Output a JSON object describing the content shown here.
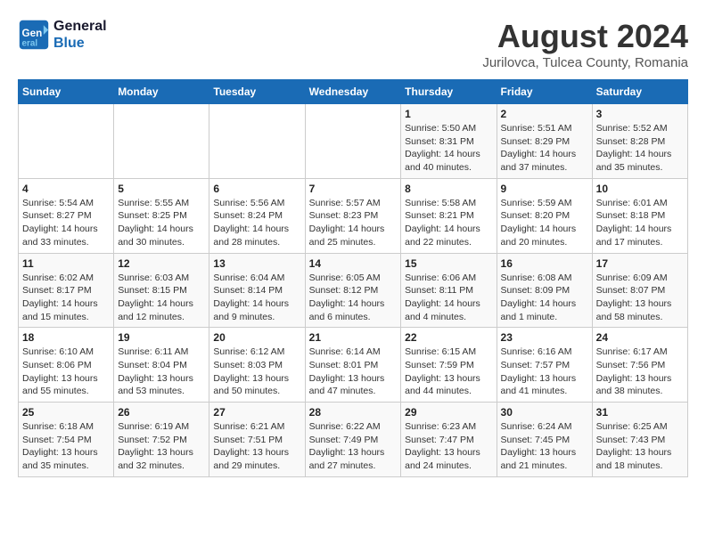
{
  "logo": {
    "line1": "General",
    "line2": "Blue"
  },
  "title": "August 2024",
  "subtitle": "Jurilovca, Tulcea County, Romania",
  "days_header": [
    "Sunday",
    "Monday",
    "Tuesday",
    "Wednesday",
    "Thursday",
    "Friday",
    "Saturday"
  ],
  "weeks": [
    [
      {
        "num": "",
        "info": ""
      },
      {
        "num": "",
        "info": ""
      },
      {
        "num": "",
        "info": ""
      },
      {
        "num": "",
        "info": ""
      },
      {
        "num": "1",
        "info": "Sunrise: 5:50 AM\nSunset: 8:31 PM\nDaylight: 14 hours\nand 40 minutes."
      },
      {
        "num": "2",
        "info": "Sunrise: 5:51 AM\nSunset: 8:29 PM\nDaylight: 14 hours\nand 37 minutes."
      },
      {
        "num": "3",
        "info": "Sunrise: 5:52 AM\nSunset: 8:28 PM\nDaylight: 14 hours\nand 35 minutes."
      }
    ],
    [
      {
        "num": "4",
        "info": "Sunrise: 5:54 AM\nSunset: 8:27 PM\nDaylight: 14 hours\nand 33 minutes."
      },
      {
        "num": "5",
        "info": "Sunrise: 5:55 AM\nSunset: 8:25 PM\nDaylight: 14 hours\nand 30 minutes."
      },
      {
        "num": "6",
        "info": "Sunrise: 5:56 AM\nSunset: 8:24 PM\nDaylight: 14 hours\nand 28 minutes."
      },
      {
        "num": "7",
        "info": "Sunrise: 5:57 AM\nSunset: 8:23 PM\nDaylight: 14 hours\nand 25 minutes."
      },
      {
        "num": "8",
        "info": "Sunrise: 5:58 AM\nSunset: 8:21 PM\nDaylight: 14 hours\nand 22 minutes."
      },
      {
        "num": "9",
        "info": "Sunrise: 5:59 AM\nSunset: 8:20 PM\nDaylight: 14 hours\nand 20 minutes."
      },
      {
        "num": "10",
        "info": "Sunrise: 6:01 AM\nSunset: 8:18 PM\nDaylight: 14 hours\nand 17 minutes."
      }
    ],
    [
      {
        "num": "11",
        "info": "Sunrise: 6:02 AM\nSunset: 8:17 PM\nDaylight: 14 hours\nand 15 minutes."
      },
      {
        "num": "12",
        "info": "Sunrise: 6:03 AM\nSunset: 8:15 PM\nDaylight: 14 hours\nand 12 minutes."
      },
      {
        "num": "13",
        "info": "Sunrise: 6:04 AM\nSunset: 8:14 PM\nDaylight: 14 hours\nand 9 minutes."
      },
      {
        "num": "14",
        "info": "Sunrise: 6:05 AM\nSunset: 8:12 PM\nDaylight: 14 hours\nand 6 minutes."
      },
      {
        "num": "15",
        "info": "Sunrise: 6:06 AM\nSunset: 8:11 PM\nDaylight: 14 hours\nand 4 minutes."
      },
      {
        "num": "16",
        "info": "Sunrise: 6:08 AM\nSunset: 8:09 PM\nDaylight: 14 hours\nand 1 minute."
      },
      {
        "num": "17",
        "info": "Sunrise: 6:09 AM\nSunset: 8:07 PM\nDaylight: 13 hours\nand 58 minutes."
      }
    ],
    [
      {
        "num": "18",
        "info": "Sunrise: 6:10 AM\nSunset: 8:06 PM\nDaylight: 13 hours\nand 55 minutes."
      },
      {
        "num": "19",
        "info": "Sunrise: 6:11 AM\nSunset: 8:04 PM\nDaylight: 13 hours\nand 53 minutes."
      },
      {
        "num": "20",
        "info": "Sunrise: 6:12 AM\nSunset: 8:03 PM\nDaylight: 13 hours\nand 50 minutes."
      },
      {
        "num": "21",
        "info": "Sunrise: 6:14 AM\nSunset: 8:01 PM\nDaylight: 13 hours\nand 47 minutes."
      },
      {
        "num": "22",
        "info": "Sunrise: 6:15 AM\nSunset: 7:59 PM\nDaylight: 13 hours\nand 44 minutes."
      },
      {
        "num": "23",
        "info": "Sunrise: 6:16 AM\nSunset: 7:57 PM\nDaylight: 13 hours\nand 41 minutes."
      },
      {
        "num": "24",
        "info": "Sunrise: 6:17 AM\nSunset: 7:56 PM\nDaylight: 13 hours\nand 38 minutes."
      }
    ],
    [
      {
        "num": "25",
        "info": "Sunrise: 6:18 AM\nSunset: 7:54 PM\nDaylight: 13 hours\nand 35 minutes."
      },
      {
        "num": "26",
        "info": "Sunrise: 6:19 AM\nSunset: 7:52 PM\nDaylight: 13 hours\nand 32 minutes."
      },
      {
        "num": "27",
        "info": "Sunrise: 6:21 AM\nSunset: 7:51 PM\nDaylight: 13 hours\nand 29 minutes."
      },
      {
        "num": "28",
        "info": "Sunrise: 6:22 AM\nSunset: 7:49 PM\nDaylight: 13 hours\nand 27 minutes."
      },
      {
        "num": "29",
        "info": "Sunrise: 6:23 AM\nSunset: 7:47 PM\nDaylight: 13 hours\nand 24 minutes."
      },
      {
        "num": "30",
        "info": "Sunrise: 6:24 AM\nSunset: 7:45 PM\nDaylight: 13 hours\nand 21 minutes."
      },
      {
        "num": "31",
        "info": "Sunrise: 6:25 AM\nSunset: 7:43 PM\nDaylight: 13 hours\nand 18 minutes."
      }
    ]
  ]
}
